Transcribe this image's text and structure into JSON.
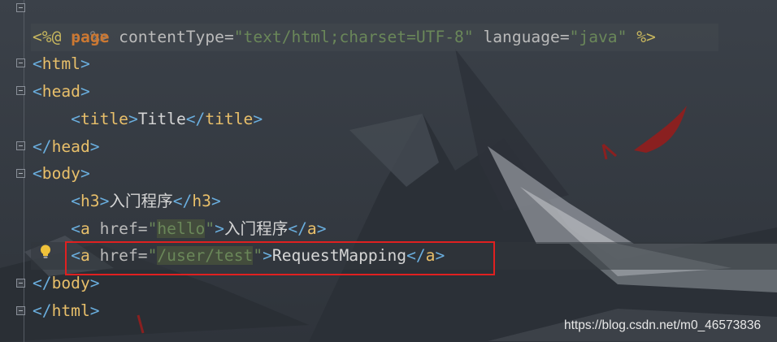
{
  "editor": {
    "lines": [
      {
        "id": "comment-close",
        "text": "--%>"
      },
      {
        "id": "page-directive",
        "open": "<%@",
        "keyword": "page",
        "attr1": "contentType",
        "eq1": "=",
        "val1": "\"text/html;charset=UTF-8\"",
        "attr2": "language",
        "eq2": "=",
        "val2": "\"java\"",
        "close": "%>"
      },
      {
        "id": "html-open",
        "lt": "<",
        "tag": "html",
        "gt": ">"
      },
      {
        "id": "head-open",
        "lt": "<",
        "tag": "head",
        "gt": ">"
      },
      {
        "id": "title",
        "lt1": "<",
        "tag1": "title",
        "gt1": ">",
        "text": "Title",
        "lt2": "</",
        "tag2": "title",
        "gt2": ">"
      },
      {
        "id": "head-close",
        "lt": "</",
        "tag": "head",
        "gt": ">"
      },
      {
        "id": "body-open",
        "lt": "<",
        "tag": "body",
        "gt": ">"
      },
      {
        "id": "h3",
        "lt1": "<",
        "tag1": "h3",
        "gt1": ">",
        "text": "入门程序",
        "lt2": "</",
        "tag2": "h3",
        "gt2": ">"
      },
      {
        "id": "a-hello",
        "lt1": "<",
        "tag1": "a",
        "attr": " href",
        "eq": "=",
        "q1": "\"",
        "href": "hello",
        "q2": "\"",
        "gt1": ">",
        "text": "入门程序",
        "lt2": "</",
        "tag2": "a",
        "gt2": ">"
      },
      {
        "id": "a-request",
        "lt1": "<",
        "tag1": "a",
        "attr": " href",
        "eq": "=",
        "q1": "\"",
        "href": "/user/test",
        "q2": "\"",
        "gt1": ">",
        "text": "RequestMapping",
        "lt2": "</",
        "tag2": "a",
        "gt2": ">"
      },
      {
        "id": "body-close",
        "lt": "</",
        "tag": "body",
        "gt": ">"
      },
      {
        "id": "html-close",
        "lt": "</",
        "tag": "html",
        "gt": ">"
      }
    ]
  },
  "icons": {
    "bulb": "lightbulb-icon",
    "fold": "fold-marker-icon"
  },
  "colors": {
    "highlight_box": "#e02020",
    "tag": "#e8bf6a",
    "bracket": "#6aaede",
    "string": "#6a8759"
  },
  "watermark": "https://blog.csdn.net/m0_46573836"
}
